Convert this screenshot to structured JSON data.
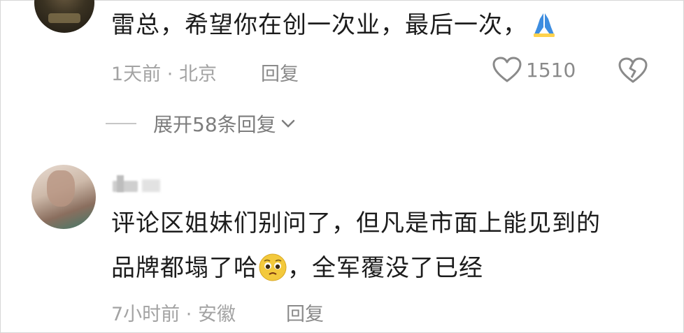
{
  "comment1": {
    "text": "雷总，希望你在创一次业，最后一次，",
    "emoji": "pray-emoji",
    "time": "1天前",
    "location": "北京",
    "reply_label": "回复",
    "likes": "1510",
    "expand_label": "展开58条回复"
  },
  "comment2": {
    "line1": "评论区姐妹们别问了，但凡是市面上能见到的",
    "line2_a": "品牌都塌了哈",
    "emoji": "pleading-face-emoji",
    "line2_b": "，全军覆没了已经",
    "time": "7小时前",
    "location": "安徽",
    "reply_label": "回复"
  },
  "separator": "·",
  "icons": [
    "heart-icon",
    "broken-heart-icon",
    "chevron-down-icon"
  ],
  "colors": {
    "text": "#1c1c1c",
    "meta": "#a3a3a3",
    "reply": "#8a8a8a",
    "emoji_blue": "#3d8de0",
    "emoji_yellow": "#f3c93c"
  }
}
